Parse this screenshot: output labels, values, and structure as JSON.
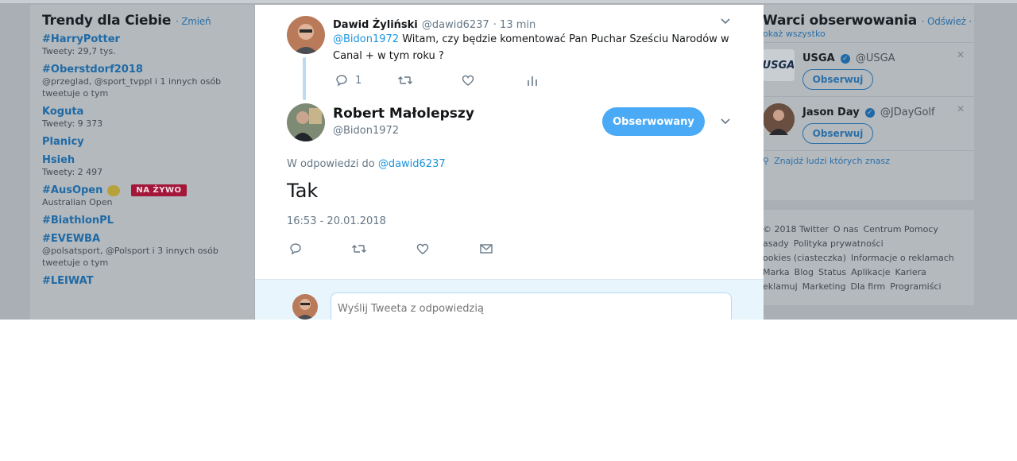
{
  "trends": {
    "title": "Trendy dla Ciebie",
    "change": "· Zmień",
    "items": [
      {
        "tag": "#HarryPotter",
        "meta": "Tweety: 29,7 tys."
      },
      {
        "tag": "#Oberstdorf2018",
        "meta": "@przeglad, @sport_tvppl i 1 innych osób tweetuje o tym"
      },
      {
        "tag": "Koguta",
        "meta": "Tweety: 9 373"
      },
      {
        "tag": "Planicy",
        "meta": ""
      },
      {
        "tag": "Hsieh",
        "meta": "Tweety: 2 497"
      },
      {
        "tag": "#AusOpen",
        "meta": "Australian Open",
        "badge": "NA ŻYWO"
      },
      {
        "tag": "#BiathlonPL",
        "meta": ""
      },
      {
        "tag": "#EVEWBA",
        "meta": "@polsatsport, @Polsport i 3 innych osób tweetuje o tym"
      },
      {
        "tag": "#LEIWAT",
        "meta": ""
      }
    ]
  },
  "who": {
    "title": "Warci obserwowania",
    "refresh": "· Odśwież ·",
    "show_all": "okaż wszystko",
    "suggestions": [
      {
        "name": "USGA",
        "handle": "@USGA",
        "button": "Obserwuj",
        "logo": "USGA"
      },
      {
        "name": "Jason Day",
        "handle": "@JDayGolf",
        "button": "Obserwuj"
      }
    ],
    "find": "Znajdź ludzi których znasz"
  },
  "footer": {
    "lines": [
      [
        "© 2018 Twitter",
        "O nas",
        "Centrum Pomocy"
      ],
      [
        "asady",
        "Polityka prywatności"
      ],
      [
        "ookies (ciasteczka)",
        "Informacje o reklamach"
      ],
      [
        "Marka",
        "Blog",
        "Status",
        "Aplikacje",
        "Kariera"
      ],
      [
        "eklamuj",
        "Marketing",
        "Dla firm",
        "Programiści"
      ]
    ]
  },
  "parent_tweet": {
    "name": "Dawid Żyliński",
    "handle": "@dawid6237",
    "time": "· 13 min",
    "mention": "@Bidon1972",
    "text_line1": " Witam, czy będzie komentować Pan Puchar Sześciu Narodów w",
    "text_line2": "Canal + w tym roku ?",
    "reply_count": "1"
  },
  "main_tweet": {
    "name": "Robert Małolepszy",
    "handle": "@Bidon1972",
    "follow_button": "Obserwowany",
    "reply_prefix": "W odpowiedzi do",
    "reply_to": "@dawid6237",
    "text": "Tak",
    "timestamp": "16:53 - 20.01.2018"
  },
  "reply": {
    "placeholder": "Wyślij Tweeta z odpowiedzią"
  },
  "colors": {
    "accent": "#1b95e0",
    "follow_bg": "#4aaaf5",
    "live_badge": "#a3173a"
  }
}
